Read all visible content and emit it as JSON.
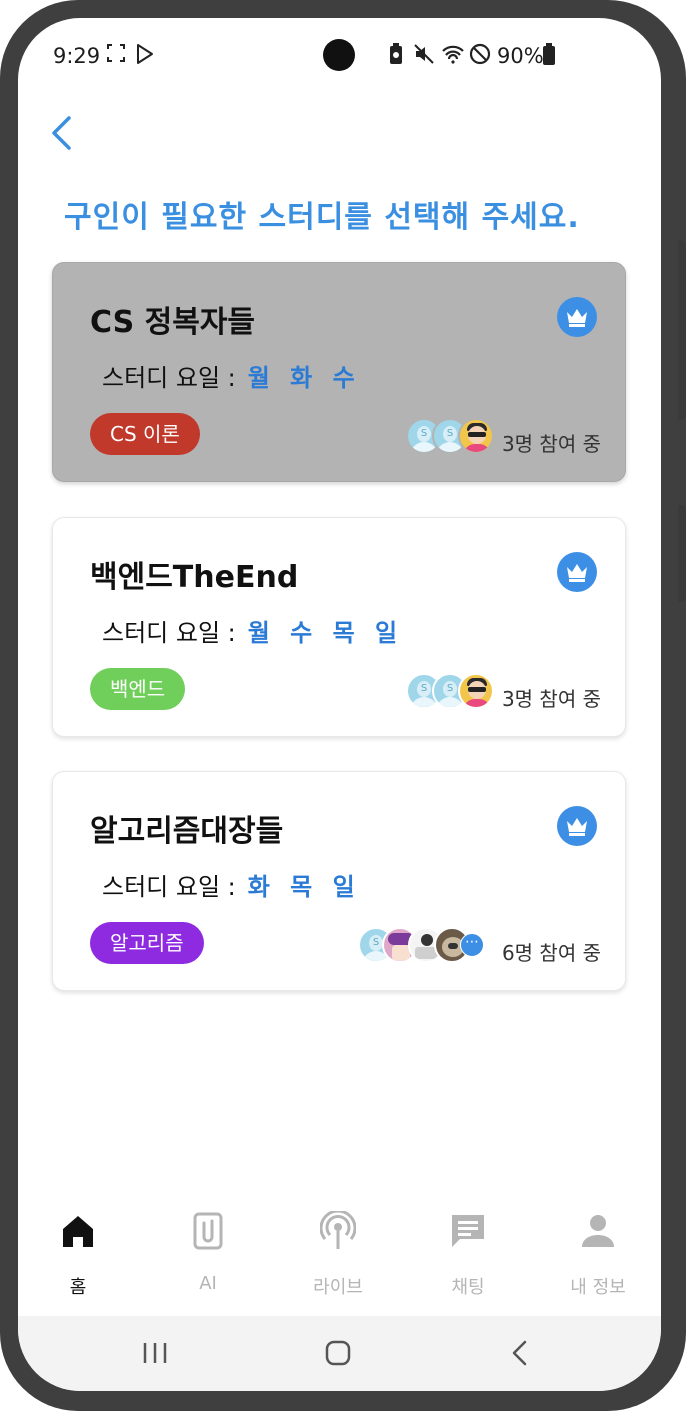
{
  "status_bar": {
    "time": "9:29",
    "battery_percent": "90%",
    "icons": [
      "screenshot-icon",
      "play-store-icon",
      "battery-saver-icon",
      "mute-icon",
      "wifi-icon",
      "do-not-disturb-icon",
      "battery-icon"
    ]
  },
  "header": {
    "back_icon": "chevron-left-icon",
    "title": "구인이 필요한 스터디를 선택해 주세요."
  },
  "studies": [
    {
      "name": "CS 정복자들",
      "days_label": "스터디 요일 :",
      "days": "월 화 수",
      "tag": "CS 이론",
      "tag_color": "#c0392b",
      "participants": "3명 참여 중",
      "owner_badge": "crown-icon",
      "selected": true
    },
    {
      "name": "백엔드TheEnd",
      "days_label": "스터디 요일 :",
      "days": "월 수 목 일",
      "tag": "백엔드",
      "tag_color": "#6fcf5a",
      "participants": "3명 참여 중",
      "owner_badge": "crown-icon",
      "selected": false
    },
    {
      "name": "알고리즘대장들",
      "days_label": "스터디 요일 :",
      "days": "화 목 일",
      "tag": "알고리즘",
      "tag_color": "#8e2be0",
      "participants": "6명 참여 중",
      "owner_badge": "crown-icon",
      "selected": false
    }
  ],
  "bottom_nav": {
    "items": [
      {
        "label": "홈",
        "icon": "home-icon",
        "active": true
      },
      {
        "label": "AI",
        "icon": "document-icon",
        "active": false
      },
      {
        "label": "라이브",
        "icon": "live-icon",
        "active": false
      },
      {
        "label": "채팅",
        "icon": "chat-icon",
        "active": false
      },
      {
        "label": "내 정보",
        "icon": "profile-icon",
        "active": false
      }
    ]
  },
  "colors": {
    "accent": "#3a8fe0",
    "days_blue": "#2b7bd6",
    "selected_card": "#b3b3b3",
    "crown_badge": "#3d8fe6"
  }
}
